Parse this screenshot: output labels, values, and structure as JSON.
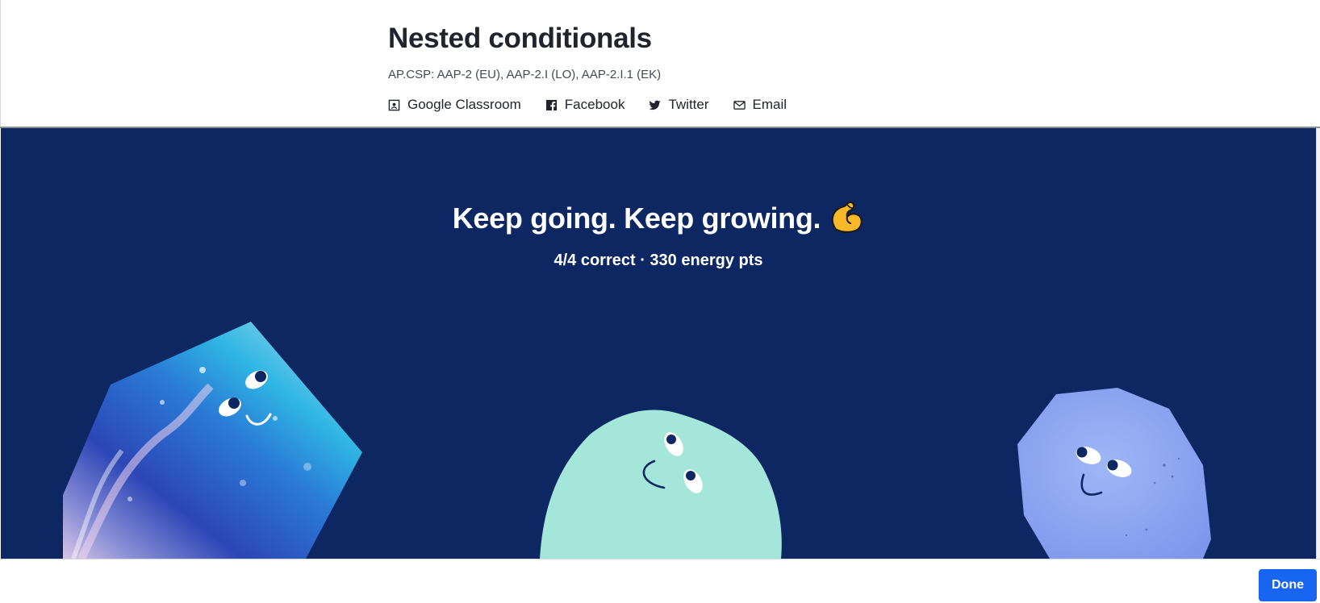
{
  "header": {
    "title": "Nested conditionals",
    "standards": "AP.CSP: AAP-2 (EU), AAP-2.I (LO), AAP-2.I.1 (EK)",
    "share": [
      {
        "label": "Google Classroom",
        "icon": "google-classroom-icon"
      },
      {
        "label": "Facebook",
        "icon": "facebook-icon"
      },
      {
        "label": "Twitter",
        "icon": "twitter-icon"
      },
      {
        "label": "Email",
        "icon": "email-icon"
      }
    ]
  },
  "hero": {
    "title": "Keep going. Keep growing.",
    "title_icon": "flexed-biceps-icon",
    "summary": "4/4 correct · 330 energy pts",
    "background_color": "#0c2762"
  },
  "footer": {
    "done_label": "Done",
    "accent_color": "#1865f2"
  }
}
